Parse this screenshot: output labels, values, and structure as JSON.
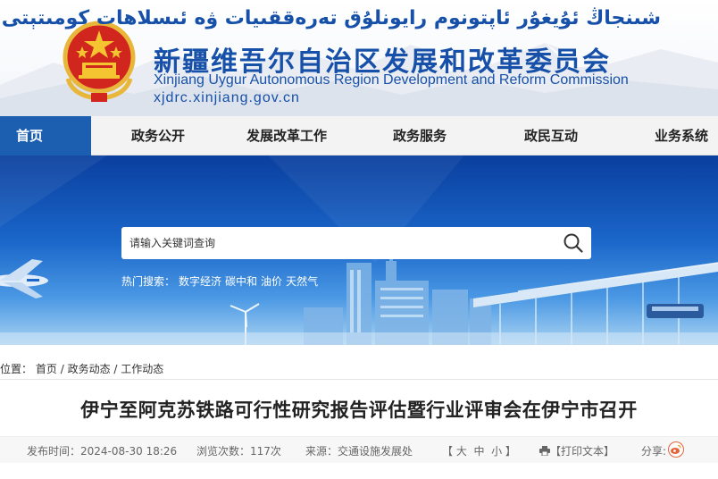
{
  "header": {
    "title_uyghur": "شىنجاڭ ئۇيغۇر ئاپتونوم رايونلۇق تەرەققىيات ۋە ئىسلاھات كومىتېتى",
    "title_chinese": "新疆维吾尔自治区发展和改革委员会",
    "title_english": "Xinjiang Uygur Autonomous Region Development and Reform Commission",
    "url": "xjdrc.xinjiang.gov.cn"
  },
  "nav": {
    "items": [
      {
        "label": "首页",
        "active": true
      },
      {
        "label": "政务公开"
      },
      {
        "label": "发展改革工作"
      },
      {
        "label": "政务服务"
      },
      {
        "label": "政民互动"
      },
      {
        "label": "业务系统"
      }
    ]
  },
  "search": {
    "placeholder": "请输入关键词查询",
    "hot_label": "热门搜索：",
    "hot_keywords": [
      "数字经济",
      "碳中和",
      "油价",
      "天然气"
    ]
  },
  "breadcrumb": {
    "prefix": "位置：",
    "items": [
      "首页",
      "政务动态",
      "工作动态"
    ],
    "separator": "/"
  },
  "article": {
    "title": "伊宁至阿克苏铁路可行性研究报告评估暨行业评审会在伊宁市召开",
    "publish_label": "发布时间：",
    "publish_time": "2024-08-30 18:26",
    "views_label": "浏览次数：",
    "views": "117次",
    "source_label": "来源：",
    "source": "交通设施发展处",
    "font_size_controls": "【 大  中  小 】",
    "print_label": "【打印文本】",
    "share_label": "分享:"
  },
  "colors": {
    "brand_blue": "#1650a8",
    "nav_active": "#1c5fb0"
  }
}
